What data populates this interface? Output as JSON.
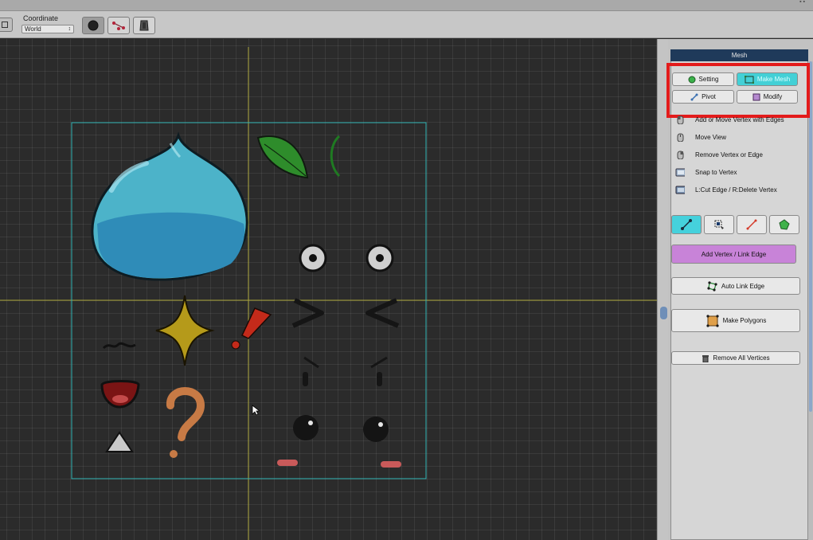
{
  "window": {
    "controls": "▪ ▪"
  },
  "toolbar": {
    "coordinate_label": "Coordinate",
    "coordinate_value": "World",
    "buttons": [
      {
        "icon": "circle-tool-icon",
        "pressed": true
      },
      {
        "icon": "vertex-link-icon",
        "pressed": false
      },
      {
        "icon": "mesh-tool-icon",
        "pressed": false
      }
    ]
  },
  "panel": {
    "title": "Mesh",
    "tabs": {
      "setting": "Setting",
      "make_mesh": "Make Mesh",
      "pivot": "Pivot",
      "modify": "Modify"
    },
    "help_items": [
      {
        "icon": "mouse-left-icon",
        "text": "Add or Move Vertex with Edges"
      },
      {
        "icon": "mouse-middle-icon",
        "text": "Move View"
      },
      {
        "icon": "mouse-right-icon",
        "text": "Remove Vertex or Edge"
      },
      {
        "icon": "key-icon",
        "text": "Snap to Vertex"
      },
      {
        "icon": "key-combo-icon",
        "text": "L:Cut Edge / R:Delete Vertex"
      }
    ],
    "tools": [
      {
        "icon": "add-vertex-tool-icon",
        "active": true
      },
      {
        "icon": "select-vertex-tool-icon",
        "active": false
      },
      {
        "icon": "cut-edge-tool-icon",
        "active": false
      },
      {
        "icon": "polygon-tool-icon",
        "active": false
      }
    ],
    "add_vertex_label": "Add Vertex / Link Edge",
    "auto_link_label": "Auto Link Edge",
    "make_polygons_label": "Make Polygons",
    "remove_all_label": "Remove All Vertices"
  },
  "colors": {
    "accent_cyan": "#43d0d6",
    "accent_pink": "#c883d8",
    "highlight_red": "#e31b1b",
    "canvas_bg": "#2b2b2b",
    "image_border": "#2fb3b3",
    "axis_line": "#a9a43a"
  }
}
